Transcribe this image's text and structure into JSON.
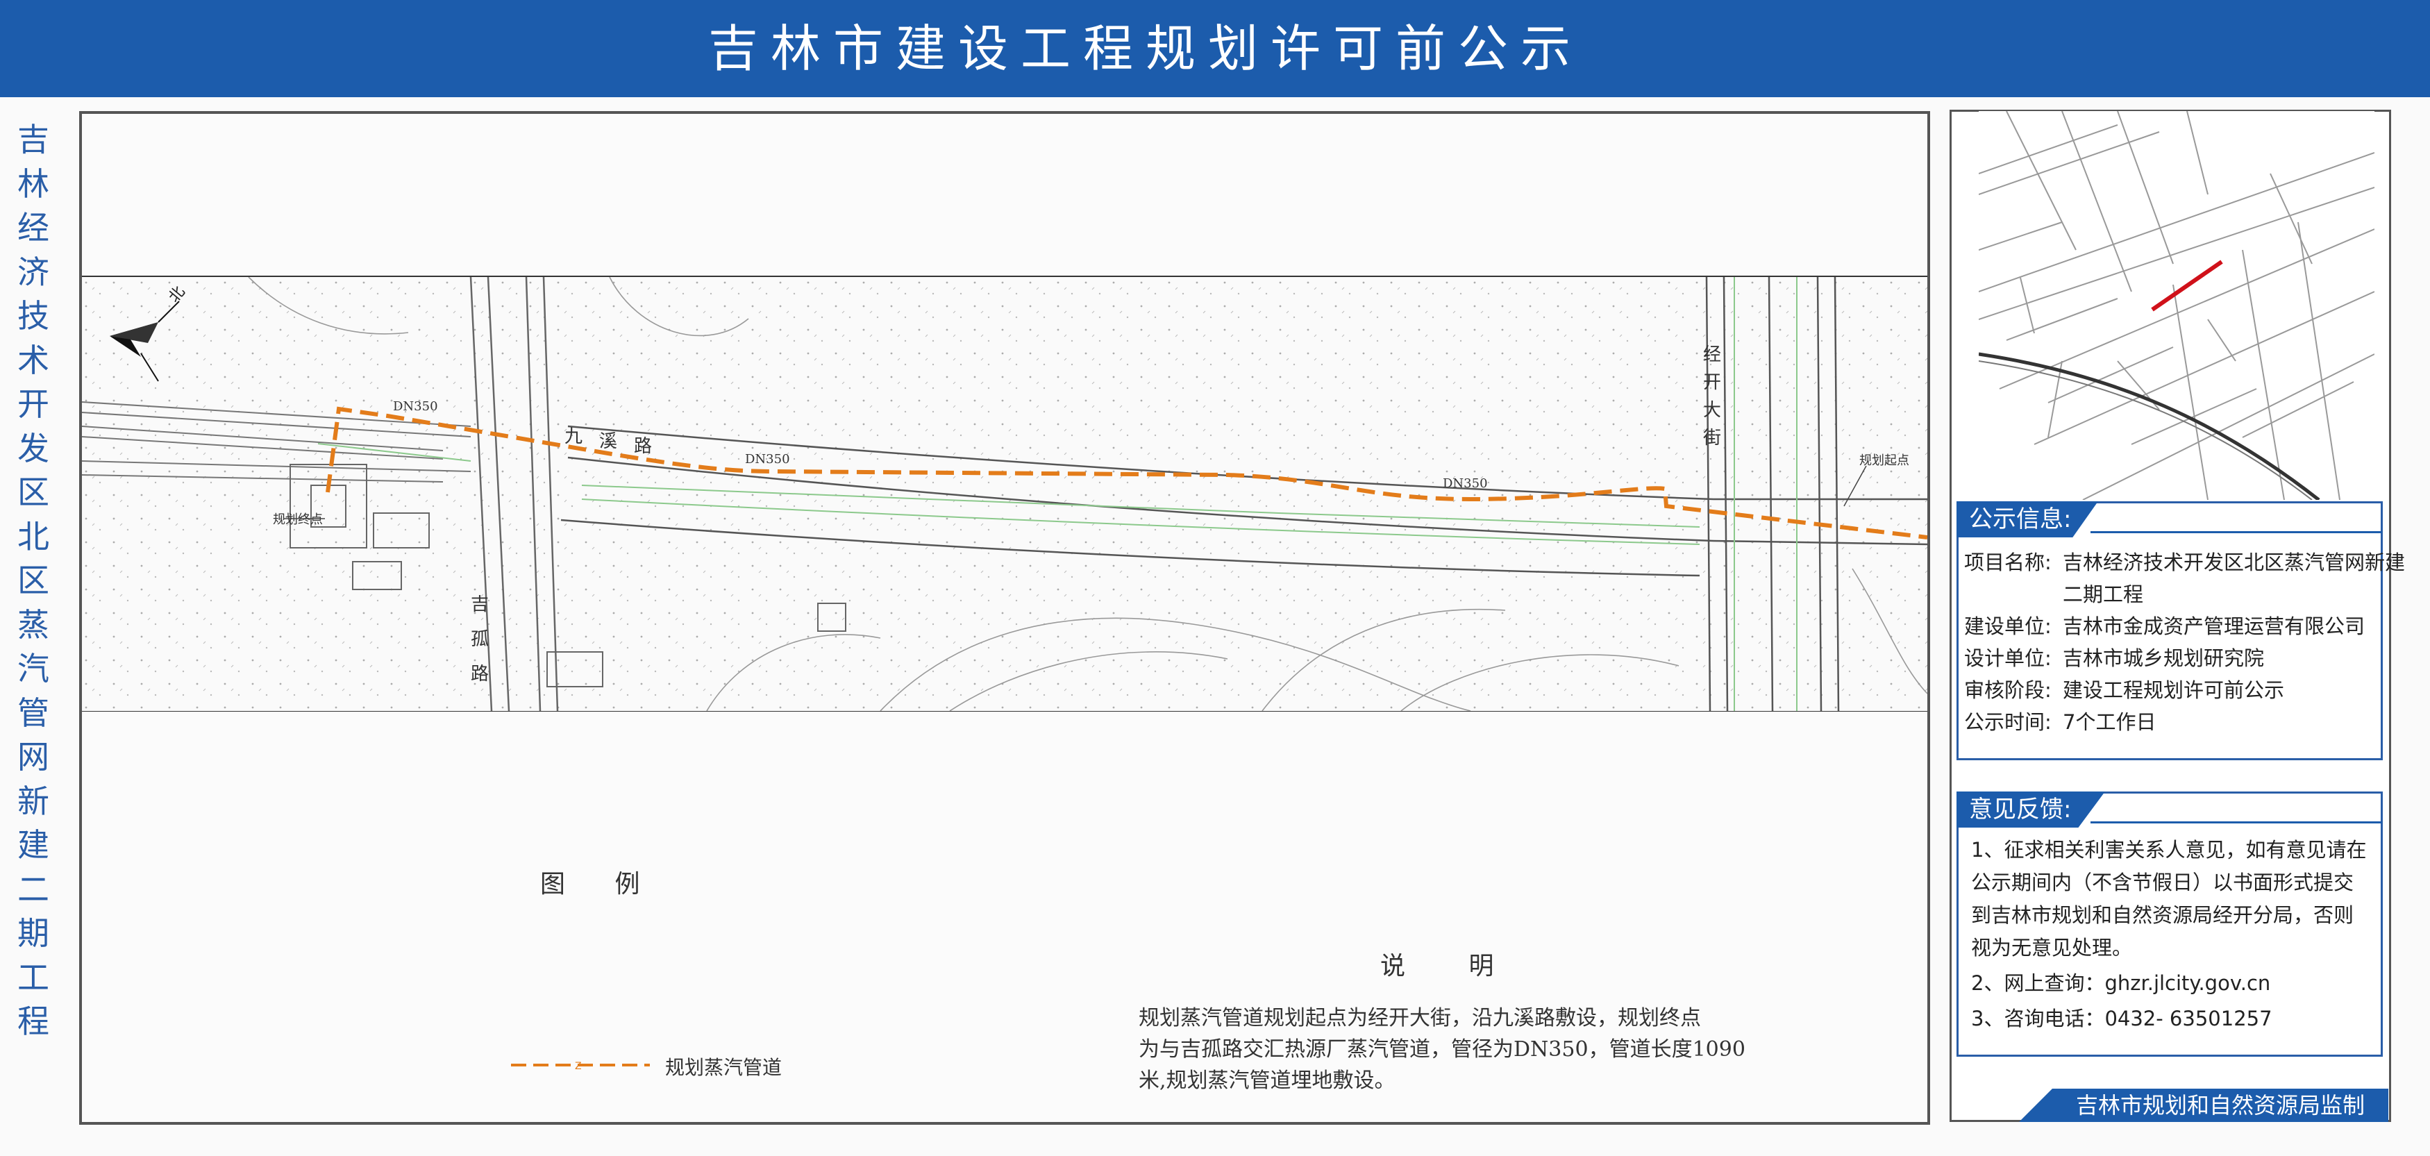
{
  "header": {
    "title": "吉林市建设工程规划许可前公示"
  },
  "side_title": {
    "chars": [
      "吉",
      "林",
      "经",
      "济",
      "技",
      "术",
      "开",
      "发",
      "区",
      "北",
      "区",
      "蒸",
      "汽",
      "管",
      "网",
      "新",
      "建",
      "二",
      "期",
      "工",
      "程"
    ]
  },
  "map": {
    "north_label": "北",
    "labels": {
      "dn1": "DN350",
      "dn2": "DN350",
      "dn3": "DN350",
      "road_jiuxi": [
        "九",
        "溪",
        "路"
      ],
      "road_jigu": [
        "吉",
        "孤",
        "路"
      ],
      "road_jingkai": [
        "经",
        "开",
        "大",
        "街"
      ],
      "start_point": "规划起点",
      "end_point": "规划终点"
    },
    "colors": {
      "pipeline": "#e37c1a",
      "roads": "#555555",
      "green": "#8cc98c"
    }
  },
  "legend": {
    "title": "图 例",
    "item_label": "规划蒸汽管道",
    "line_mark": "Z"
  },
  "description": {
    "title": "说 明",
    "lines": [
      "规划蒸汽管道规划起点为经开大街，沿九溪路敷设，规划终点",
      "为与吉孤路交汇热源厂蒸汽管道，管径为DN350，管道长度1090",
      "米,规划蒸汽管道埋地敷设。"
    ]
  },
  "info": {
    "heading": "公示信息:",
    "project_label": "项目名称:",
    "project_value_1": "吉林经济技术开发区北区蒸汽管网新建",
    "project_value_2": "二期工程",
    "builder_label": "建设单位:",
    "builder_value": "吉林市金成资产管理运营有限公司",
    "designer_label": "设计单位:",
    "designer_value": "吉林市城乡规划研究院",
    "stage_label": "审核阶段:",
    "stage_value": "建设工程规划许可前公示",
    "period_label": "公示时间:",
    "period_value": "7个工作日"
  },
  "feedback": {
    "heading": "意见反馈:",
    "lines": [
      "1、征求相关利害关系人意见，如有意见请在",
      "公示期间内（不含节假日）以书面形式提交",
      "到吉林市规划和自然资源局经开分局，否则",
      "视为无意见处理。",
      "2、网上查询：ghzr.jlcity.gov.cn",
      "3、咨询电话：0432- 63501257"
    ]
  },
  "footer": {
    "supervisor": "吉林市规划和自然资源局监制"
  },
  "colors": {
    "brand": "#1c5cac",
    "accent_text": "#2a5ea8",
    "route_red": "#d0111a"
  }
}
